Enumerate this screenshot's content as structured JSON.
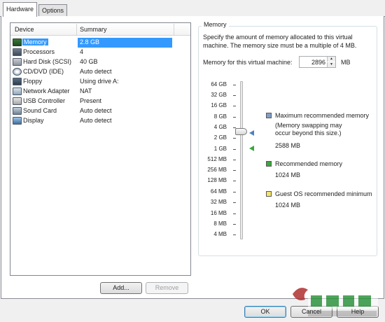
{
  "tabs": [
    {
      "label": "Hardware",
      "active": true
    },
    {
      "label": "Options",
      "active": false
    }
  ],
  "device_list": {
    "columns": [
      "Device",
      "Summary"
    ],
    "rows": [
      {
        "device": "Memory",
        "summary": "2.8 GB",
        "icon": "memory-icon",
        "selected": true
      },
      {
        "device": "Processors",
        "summary": "4",
        "icon": "processor-icon"
      },
      {
        "device": "Hard Disk (SCSI)",
        "summary": "40 GB",
        "icon": "hard-disk-icon"
      },
      {
        "device": "CD/DVD (IDE)",
        "summary": "Auto detect",
        "icon": "cd-dvd-icon"
      },
      {
        "device": "Floppy",
        "summary": "Using drive A:",
        "icon": "floppy-icon"
      },
      {
        "device": "Network Adapter",
        "summary": "NAT",
        "icon": "network-adapter-icon"
      },
      {
        "device": "USB Controller",
        "summary": "Present",
        "icon": "usb-controller-icon"
      },
      {
        "device": "Sound Card",
        "summary": "Auto detect",
        "icon": "sound-card-icon"
      },
      {
        "device": "Display",
        "summary": "Auto detect",
        "icon": "display-icon"
      }
    ],
    "add_label": "Add...",
    "remove_label": "Remove"
  },
  "memory": {
    "group_title": "Memory",
    "description": "Specify the amount of memory allocated to this virtual machine. The memory size must be a multiple of 4 MB.",
    "field_label": "Memory for this virtual machine:",
    "value": "2896",
    "unit": "MB",
    "scale": [
      "64 GB",
      "32 GB",
      "16 GB",
      "8 GB",
      "4 GB",
      "2 GB",
      "1 GB",
      "512 MB",
      "256 MB",
      "128 MB",
      "64 MB",
      "32 MB",
      "16 MB",
      "8 MB",
      "4 MB"
    ],
    "legend": {
      "max_label": "Maximum recommended memory",
      "max_note": "(Memory swapping may occur beyond this size.)",
      "max_value": "2588 MB",
      "rec_label": "Recommended memory",
      "rec_value": "1024 MB",
      "min_label": "Guest OS recommended minimum",
      "min_value": "1024 MB"
    },
    "colors": {
      "max": "#7f9fc7",
      "rec": "#3aa83a",
      "min": "#f4e46a"
    }
  },
  "footer": {
    "ok_label": "OK",
    "cancel_label": "Cancel",
    "help_label": "Help"
  }
}
